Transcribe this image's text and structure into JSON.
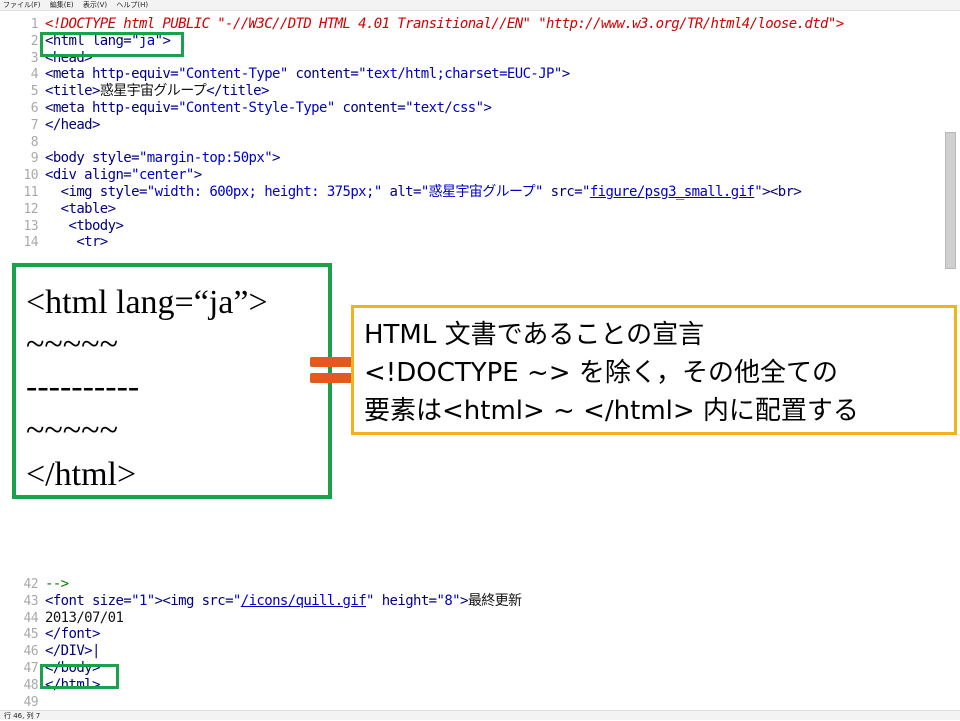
{
  "menu": {
    "items": [
      "ファイル(F)",
      "編集(E)",
      "表示(V)",
      "ヘルプ(H)"
    ]
  },
  "editor": {
    "lines": [
      {
        "num": "1",
        "segments": [
          {
            "text": "<!DOCTYPE html PUBLIC \"-//W3C//DTD HTML 4.01 Transitional//EN\" \"http://www.w3.org/TR/html4/loose.dtd\">",
            "type": "doctype"
          }
        ]
      },
      {
        "num": "2",
        "segments": [
          {
            "text": "<html lang=",
            "type": "tag"
          },
          {
            "text": "\"ja\"",
            "type": "str"
          },
          {
            "text": ">",
            "type": "tag"
          }
        ]
      },
      {
        "num": "3",
        "segments": [
          {
            "text": "<head>",
            "type": "tag"
          }
        ]
      },
      {
        "num": "4",
        "segments": [
          {
            "text": "<meta http-equiv=",
            "type": "tag"
          },
          {
            "text": "\"Content-Type\"",
            "type": "str"
          },
          {
            "text": " content=",
            "type": "tag"
          },
          {
            "text": "\"text/html;charset=EUC-JP\"",
            "type": "str"
          },
          {
            "text": ">",
            "type": "tag"
          }
        ]
      },
      {
        "num": "5",
        "segments": [
          {
            "text": "<title>",
            "type": "tag"
          },
          {
            "text": "惑星宇宙グループ",
            "type": "text"
          },
          {
            "text": "</title>",
            "type": "tag"
          }
        ]
      },
      {
        "num": "6",
        "segments": [
          {
            "text": "<meta http-equiv=",
            "type": "tag"
          },
          {
            "text": "\"Content-Style-Type\"",
            "type": "str"
          },
          {
            "text": " content=",
            "type": "tag"
          },
          {
            "text": "\"text/css\"",
            "type": "str"
          },
          {
            "text": ">",
            "type": "tag"
          }
        ]
      },
      {
        "num": "7",
        "segments": [
          {
            "text": "</head>",
            "type": "tag"
          }
        ]
      },
      {
        "num": "8",
        "segments": []
      },
      {
        "num": "9",
        "segments": [
          {
            "text": "<body style=",
            "type": "tag"
          },
          {
            "text": "\"margin-top:50px\"",
            "type": "str"
          },
          {
            "text": ">",
            "type": "tag"
          }
        ]
      },
      {
        "num": "10",
        "segments": [
          {
            "text": "<div align=",
            "type": "tag"
          },
          {
            "text": "\"center\"",
            "type": "str"
          },
          {
            "text": ">",
            "type": "tag"
          }
        ]
      },
      {
        "num": "11",
        "segments": [
          {
            "text": "  <img style=",
            "type": "tag"
          },
          {
            "text": "\"width: 600px; height: 375px;\"",
            "type": "str"
          },
          {
            "text": " alt=",
            "type": "tag"
          },
          {
            "text": "\"惑星宇宙グループ\"",
            "type": "str"
          },
          {
            "text": " src=",
            "type": "tag"
          },
          {
            "text": "\"",
            "type": "str"
          },
          {
            "text": "figure/psg3_small.gif",
            "type": "link"
          },
          {
            "text": "\"",
            "type": "str"
          },
          {
            "text": "><br>",
            "type": "tag"
          }
        ]
      },
      {
        "num": "12",
        "segments": [
          {
            "text": "  <table>",
            "type": "tag"
          }
        ]
      },
      {
        "num": "13",
        "segments": [
          {
            "text": "   <tbody>",
            "type": "tag"
          }
        ]
      },
      {
        "num": "14",
        "segments": [
          {
            "text": "    <tr>",
            "type": "tag"
          }
        ]
      },
      {
        "num": "42",
        "segments": [
          {
            "text": "-->",
            "type": "comment"
          }
        ]
      },
      {
        "num": "43",
        "segments": [
          {
            "text": "<font size=",
            "type": "tag"
          },
          {
            "text": "\"1\"",
            "type": "str"
          },
          {
            "text": "><img src=",
            "type": "tag"
          },
          {
            "text": "\"",
            "type": "str"
          },
          {
            "text": "/icons/quill.gif",
            "type": "link"
          },
          {
            "text": "\"",
            "type": "str"
          },
          {
            "text": " height=",
            "type": "tag"
          },
          {
            "text": "\"8\"",
            "type": "str"
          },
          {
            "text": ">",
            "type": "tag"
          },
          {
            "text": "最終更新",
            "type": "text"
          }
        ]
      },
      {
        "num": "44",
        "segments": [
          {
            "text": "2013/07/01",
            "type": "text"
          }
        ]
      },
      {
        "num": "45",
        "segments": [
          {
            "text": "</font>",
            "type": "tag"
          }
        ]
      },
      {
        "num": "46",
        "segments": [
          {
            "text": "</DIV>|",
            "type": "tag"
          }
        ]
      },
      {
        "num": "47",
        "segments": [
          {
            "text": "</body>",
            "type": "tag"
          }
        ]
      },
      {
        "num": "48",
        "segments": [
          {
            "text": "</html>",
            "type": "tag"
          }
        ]
      },
      {
        "num": "49",
        "segments": []
      }
    ]
  },
  "status": {
    "text": "行 46, 列 7"
  },
  "overlay": {
    "structure_lines": [
      "<html lang=“ja”>",
      "~~~~~",
      "----------",
      "~~~~~",
      "</html>"
    ],
    "explanation_lines": [
      "HTML 文書であることの宣言",
      "<!DOCTYPE ~> を除く，その他全ての",
      "要素は<html> ~ </html> 内に配置する"
    ]
  },
  "colors": {
    "highlight_green": "#1aa24a",
    "note_border": "#f2b21a",
    "equals_orange": "#e35a1c",
    "doctype_red": "#d40000",
    "string_blue": "#0000c8",
    "tag_navy": "#000080",
    "comment_green": "#008000"
  }
}
